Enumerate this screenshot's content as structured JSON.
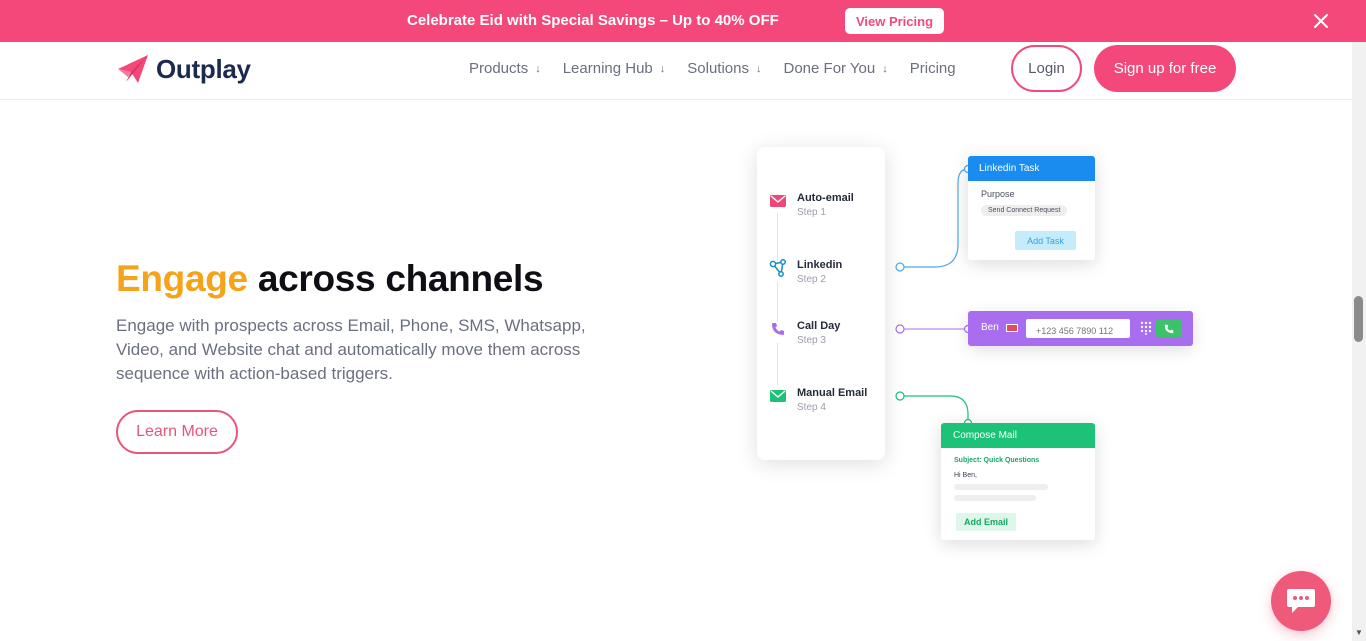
{
  "promo": {
    "text": "Celebrate Eid with Special Savings – Up to 40% OFF",
    "button_label": "View Pricing",
    "close_icon": "close-icon"
  },
  "header": {
    "logo_text": "Outplay",
    "nav": [
      {
        "label": "Products",
        "has_dropdown": true
      },
      {
        "label": "Learning Hub",
        "has_dropdown": true
      },
      {
        "label": "Solutions",
        "has_dropdown": true
      },
      {
        "label": "Done For You",
        "has_dropdown": true
      },
      {
        "label": "Pricing",
        "has_dropdown": false
      }
    ],
    "login_label": "Login",
    "signup_label": "Sign up for free"
  },
  "hero": {
    "title_accent": "Engage",
    "title_rest": " across channels",
    "description": "Engage with prospects across Email, Phone, SMS, Whatsapp, Video, and Website chat and automatically move them across sequence with action-based triggers.",
    "learn_more_label": "Learn More"
  },
  "illustration": {
    "steps": [
      {
        "name": "Auto-email",
        "sub": "Step 1",
        "icon": "mail-icon",
        "color": "#f0477a"
      },
      {
        "name": "Linkedin",
        "sub": "Step 2",
        "icon": "share-icon",
        "color": "#1a8cc7"
      },
      {
        "name": "Call Day",
        "sub": "Step 3",
        "icon": "phone-icon",
        "color": "#a96ef0"
      },
      {
        "name": "Manual Email",
        "sub": "Step 4",
        "icon": "mail-icon",
        "color": "#1bc277"
      }
    ],
    "linkedin_task": {
      "title": "Linkedin Task",
      "purpose_label": "Purpose",
      "purpose_value": "Send Connect Request",
      "button_label": "Add Task"
    },
    "call": {
      "name": "Ben",
      "phone_placeholder": "+123 456 7890 112"
    },
    "compose_mail": {
      "title": "Compose Mail",
      "subject": "Subject: Quick Questions",
      "greeting": "Hi Ben,",
      "button_label": "Add Email"
    }
  },
  "colors": {
    "brand_pink": "#f5487a",
    "accent_orange": "#f5a31a",
    "linkedin_blue": "#1a8cf0",
    "call_purple": "#a96ef0",
    "mail_green": "#1bc277"
  },
  "chat_widget": {
    "icon": "chat-icon"
  }
}
